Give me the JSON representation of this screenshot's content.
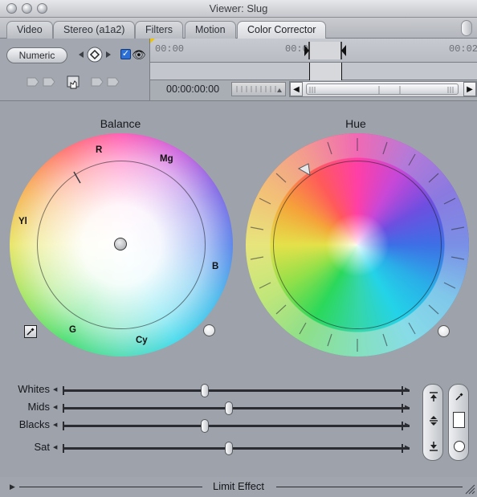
{
  "window": {
    "title": "Viewer: Slug"
  },
  "tabs": [
    {
      "label": "Video"
    },
    {
      "label": "Stereo (a1a2)"
    },
    {
      "label": "Filters"
    },
    {
      "label": "Motion"
    },
    {
      "label": "Color Corrector"
    }
  ],
  "controls": {
    "numeric_label": "Numeric",
    "view_checked": true,
    "timecode": "00:00:00:00",
    "timeline_start": "00:00",
    "timeline_mid": "00:00",
    "timeline_end": "00:02"
  },
  "balance": {
    "title": "Balance",
    "letters": {
      "r": "R",
      "mg": "Mg",
      "yl": "Yl",
      "b": "B",
      "g": "G",
      "cy": "Cy"
    }
  },
  "hue": {
    "title": "Hue"
  },
  "sliders": [
    {
      "label": "Whites",
      "value": 0.42
    },
    {
      "label": "Mids",
      "value": 0.49
    },
    {
      "label": "Blacks",
      "value": 0.42
    },
    {
      "label": "Sat",
      "value": 0.49
    }
  ],
  "limit": {
    "label": "Limit Effect"
  },
  "icons": {
    "window_controls": [
      "close-icon",
      "minimize-icon",
      "zoom-icon"
    ],
    "keyframe": "keyframe-diamond-icon",
    "eye": "eye-icon",
    "eyedropper": "eyedropper-icon",
    "select_auto_balance": "eyedropper-icon",
    "whites_auto": "whites-arrow-icon",
    "mids_auto": "mids-arrow-icon",
    "blacks_auto": "blacks-arrow-icon",
    "color_swatch": "color-swatch-icon",
    "hue_reset": "reset-icon"
  }
}
